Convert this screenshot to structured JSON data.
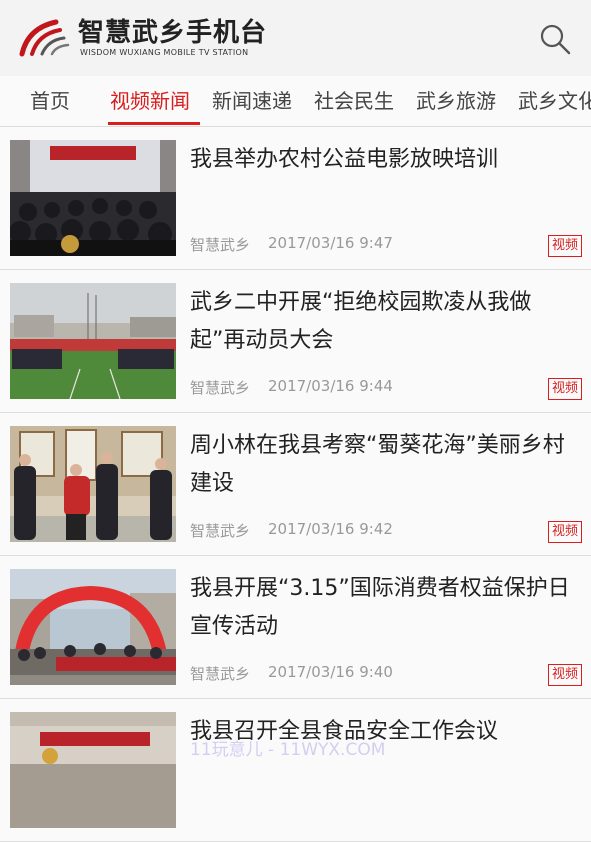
{
  "header": {
    "title": "智慧武乡手机台",
    "subtitle": "WISDOM WUXIANG MOBILE TV STATION",
    "logo_icon": "wuxiang-logo",
    "search_icon": "search-icon"
  },
  "tabs": [
    {
      "label": "首页",
      "active": false
    },
    {
      "label": "视频新闻",
      "active": true
    },
    {
      "label": "新闻速递",
      "active": false
    },
    {
      "label": "社会民生",
      "active": false
    },
    {
      "label": "武乡旅游",
      "active": false
    },
    {
      "label": "武乡文化",
      "active": false
    }
  ],
  "news": [
    {
      "title": "我县举办农村公益电影放映培训",
      "source": "智慧武乡",
      "time": "2017/03/16 9:47",
      "tag": "视频",
      "thumb": "meeting-hall-thumbnail"
    },
    {
      "title": "武乡二中开展“拒绝校园欺凌从我做起”再动员大会",
      "source": "智慧武乡",
      "time": "2017/03/16 9:44",
      "tag": "视频",
      "thumb": "school-assembly-thumbnail"
    },
    {
      "title": "周小林在我县考察“蜀葵花海”美丽乡村建设",
      "source": "智慧武乡",
      "time": "2017/03/16 9:42",
      "tag": "视频",
      "thumb": "village-visit-thumbnail"
    },
    {
      "title": "我县开展“3.15”国际消费者权益保护日宣传活动",
      "source": "智慧武乡",
      "time": "2017/03/16 9:40",
      "tag": "视频",
      "thumb": "outdoor-event-thumbnail"
    },
    {
      "title": "我县召开全县食品安全工作会议",
      "source": "",
      "time": "",
      "tag": "",
      "thumb": "conference-thumbnail"
    }
  ],
  "watermark": "11玩意儿 - 11WYX.COM",
  "colors": {
    "accent": "#d81e1e",
    "muted": "#999999",
    "divider": "#dedede"
  }
}
